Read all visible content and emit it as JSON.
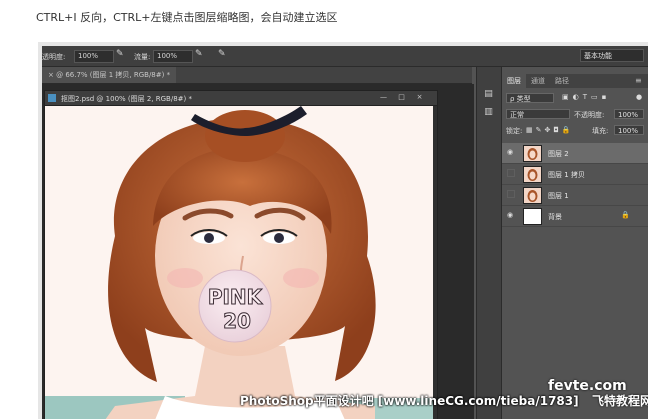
{
  "caption": "CTRL+I 反向，CTRL+左键点击图层缩略图，会自动建立选区",
  "options_bar": {
    "opacity_label": "透明度:",
    "opacity_value": "100%",
    "flow_label": "流量:",
    "flow_value": "100%",
    "workspace": "基本功能"
  },
  "tabs": {
    "background_doc": "× @ 66.7% (图层 1 拷贝, RGB/8#) *"
  },
  "document": {
    "title": "抠图2.psd @ 100% (图层 2, RGB/8#) *",
    "min": "—",
    "max": "□",
    "close": "×"
  },
  "canvas_text": {
    "line1": "PINK",
    "line2": "20"
  },
  "layers_panel": {
    "tabs": [
      "图层",
      "通道",
      "路径"
    ],
    "filter_label": "ρ 类型",
    "blend_mode": "正常",
    "opacity_label": "不透明度:",
    "opacity_value": "100%",
    "lock_label": "锁定:",
    "fill_label": "填充:",
    "fill_value": "100%",
    "layers": [
      {
        "name": "图层 2",
        "visible": true,
        "selected": true
      },
      {
        "name": "图层 1 拷贝",
        "visible": false,
        "selected": false
      },
      {
        "name": "图层 1",
        "visible": false,
        "selected": false
      },
      {
        "name": "背景",
        "visible": true,
        "selected": false,
        "locked": true
      }
    ]
  },
  "watermark": {
    "text": "PhotoShop平面设计吧 [www.lineCG.com/tieba/1783]",
    "site1": "fevte.com",
    "site2": "飞特教程网"
  },
  "colors": {
    "ps_dark": "#535353",
    "panel_bg": "#535353",
    "canvas_bg": "#fdf4f0",
    "hair": "#b4592d"
  }
}
